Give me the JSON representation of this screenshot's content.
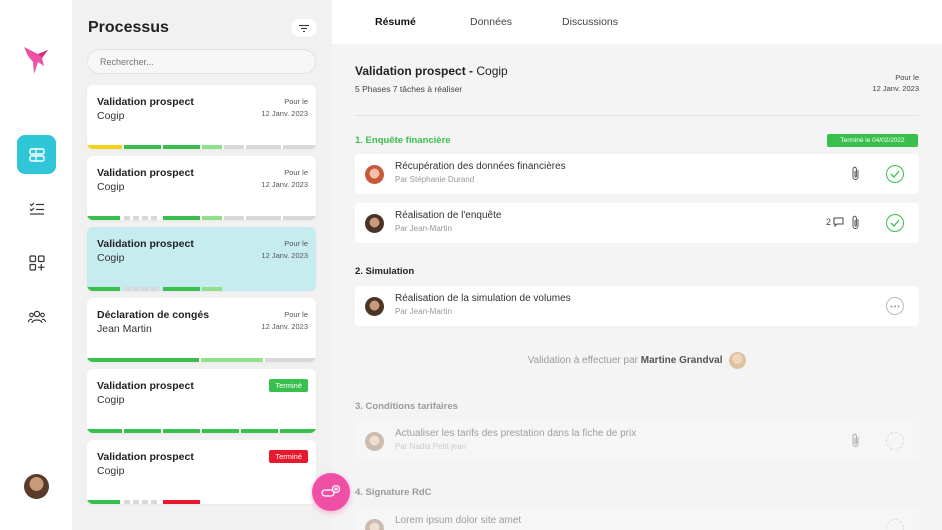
{
  "rail": {
    "items": [
      {
        "icon": "processes-icon",
        "active": true
      },
      {
        "icon": "checklist-icon",
        "active": false
      },
      {
        "icon": "apps-add-icon",
        "active": false
      },
      {
        "icon": "users-icon",
        "active": false
      }
    ],
    "avatar": "user-avatar"
  },
  "list": {
    "title": "Processus",
    "search_placeholder": "Rechercher...",
    "cards": [
      {
        "title": "Validation prospect",
        "subtitle": "Cogip",
        "due_label": "Pour le",
        "due_date": "12 Janv. 2023",
        "badge": "",
        "selected": false
      },
      {
        "title": "Validation prospect",
        "subtitle": "Cogip",
        "due_label": "Pour le",
        "due_date": "12 Janv. 2023",
        "badge": "",
        "selected": false
      },
      {
        "title": "Validation prospect",
        "subtitle": "Cogip",
        "due_label": "Pour le",
        "due_date": "12 Janv. 2023",
        "badge": "",
        "selected": true
      },
      {
        "title": "Déclaration de congés",
        "subtitle": "Jean Martin",
        "due_label": "Pour le",
        "due_date": "12 Janv. 2023",
        "badge": "",
        "selected": false
      },
      {
        "title": "Validation prospect",
        "subtitle": "Cogip",
        "due_label": "",
        "due_date": "",
        "badge": "Terminé",
        "badge_color": "#39c04c",
        "selected": false
      },
      {
        "title": "Validation prospect",
        "subtitle": "Cogip",
        "due_label": "",
        "due_date": "",
        "badge": "Terminé",
        "badge_color": "#e8192c",
        "selected": false
      }
    ]
  },
  "colors": {
    "accent": "#2fc6d8",
    "green": "#39c04c",
    "light_green": "#8ee08a",
    "yellow": "#f2d21b",
    "red": "#e8192c",
    "grey": "#d8d8d8",
    "pink": "#f04fa6"
  },
  "main": {
    "tabs": [
      {
        "label": "Résumé",
        "active": true
      },
      {
        "label": "Données",
        "active": false
      },
      {
        "label": "Discussions",
        "active": false
      }
    ],
    "title_bold": "Validation prospect -",
    "title_rest": " Cogip",
    "subtitle": "5 Phases 7 tâches à réaliser",
    "due_label": "Pour le",
    "due_date": "12 Janv. 2023",
    "phases": [
      {
        "label": "1. Enquête financière",
        "badge": "Terminé le 04/02/2022"
      },
      {
        "label": "2. Simulation"
      },
      {
        "label": "3. Conditions tarifaires"
      },
      {
        "label": "4. Signature RdC"
      }
    ],
    "tasks": [
      {
        "title": "Récupération des données financières",
        "by": "Par Stéphanie Durand",
        "status": "done"
      },
      {
        "title": "Réalisation de l'enquête",
        "by": "Par Jean-Martin",
        "comments": "2",
        "status": "done"
      },
      {
        "title": "Réalisation de la simulation de volumes",
        "by": "Par Jean-Martin",
        "status": "pending"
      },
      {
        "title": "Actualiser les tarifs des prestation dans la fiche de prix",
        "by": "Par Nadia Petit jean",
        "status": "todo"
      },
      {
        "title": "Lorem ipsum dolor site amet",
        "by": "",
        "status": "todo"
      }
    ],
    "validation_prefix": "Validation à effectuer par",
    "validation_person": "Martine Grandval"
  }
}
